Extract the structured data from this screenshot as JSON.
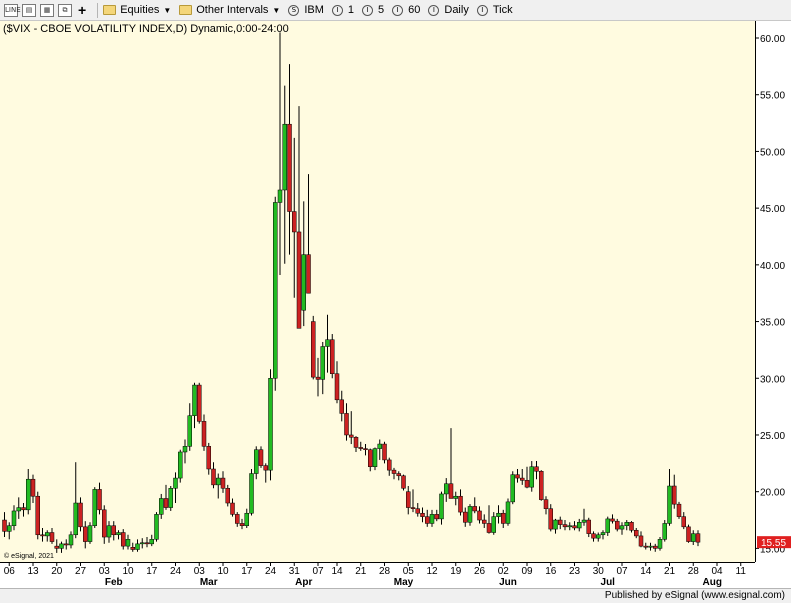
{
  "toolbar": {
    "equities_label": "Equities",
    "other_intervals_label": "Other Intervals",
    "symbol_label": "IBM",
    "interval_1": "1",
    "interval_5": "5",
    "interval_60": "60",
    "daily_label": "Daily",
    "tick_label": "Tick",
    "symbol_icon": "S",
    "interval_icon": "I"
  },
  "footer": {
    "published_by": "Published by eSignal (www.esignal.com)"
  },
  "chart_data": {
    "type": "candlestick",
    "title": "($VIX - CBOE VOLATILITY INDEX,D) Dynamic,0:00-24:00",
    "watermark": "© eSignal, 2021",
    "last_price_label": "15.55",
    "colors": {
      "up": "#22bb22",
      "down": "#cc2222",
      "background": "#fffbe0",
      "last_price": "#e02020"
    },
    "ylim": [
      13.8,
      61.5
    ],
    "yticks": [
      "15.00",
      "20.00",
      "25.00",
      "30.00",
      "35.00",
      "40.00",
      "45.00",
      "50.00",
      "55.00",
      "60.00"
    ],
    "x_tick_labels": [
      {
        "i": 1,
        "label": "06"
      },
      {
        "i": 6,
        "label": "13"
      },
      {
        "i": 11,
        "label": "20"
      },
      {
        "i": 16,
        "label": "27"
      },
      {
        "i": 21,
        "label": "03"
      },
      {
        "i": 26,
        "label": "10"
      },
      {
        "i": 31,
        "label": "17"
      },
      {
        "i": 36,
        "label": "24"
      },
      {
        "i": 41,
        "label": "03"
      },
      {
        "i": 46,
        "label": "10"
      },
      {
        "i": 51,
        "label": "17"
      },
      {
        "i": 56,
        "label": "24"
      },
      {
        "i": 61,
        "label": "31"
      },
      {
        "i": 66,
        "label": "07"
      },
      {
        "i": 70,
        "label": "14"
      },
      {
        "i": 75,
        "label": "21"
      },
      {
        "i": 80,
        "label": "28"
      },
      {
        "i": 85,
        "label": "05"
      },
      {
        "i": 90,
        "label": "12"
      },
      {
        "i": 95,
        "label": "19"
      },
      {
        "i": 100,
        "label": "26"
      },
      {
        "i": 105,
        "label": "02"
      },
      {
        "i": 110,
        "label": "09"
      },
      {
        "i": 115,
        "label": "16"
      },
      {
        "i": 120,
        "label": "23"
      },
      {
        "i": 125,
        "label": "30"
      },
      {
        "i": 130,
        "label": "07"
      },
      {
        "i": 135,
        "label": "14"
      },
      {
        "i": 140,
        "label": "21"
      },
      {
        "i": 145,
        "label": "28"
      },
      {
        "i": 150,
        "label": "04"
      },
      {
        "i": 155,
        "label": "11"
      }
    ],
    "month_labels": [
      {
        "i": 23,
        "label": "Feb"
      },
      {
        "i": 43,
        "label": "Mar"
      },
      {
        "i": 63,
        "label": "Apr"
      },
      {
        "i": 84,
        "label": "May"
      },
      {
        "i": 106,
        "label": "Jun"
      },
      {
        "i": 127,
        "label": "Jul"
      },
      {
        "i": 149,
        "label": "Aug"
      }
    ],
    "ohlc": [
      [
        17.5,
        18.2,
        16.0,
        16.5
      ],
      [
        16.5,
        17.3,
        15.8,
        17.0
      ],
      [
        17.0,
        18.8,
        16.6,
        18.3
      ],
      [
        18.3,
        19.5,
        17.6,
        18.6
      ],
      [
        18.6,
        19.0,
        17.8,
        18.4
      ],
      [
        18.4,
        22.0,
        18.0,
        21.1
      ],
      [
        21.1,
        21.5,
        19.0,
        19.6
      ],
      [
        19.6,
        20.0,
        15.8,
        16.2
      ],
      [
        16.2,
        16.8,
        15.6,
        16.1
      ],
      [
        16.1,
        16.6,
        15.6,
        16.4
      ],
      [
        16.4,
        16.8,
        15.4,
        15.6
      ],
      [
        15.2,
        15.8,
        14.6,
        15.0
      ],
      [
        15.0,
        15.6,
        14.6,
        15.4
      ],
      [
        15.4,
        15.8,
        14.9,
        15.3
      ],
      [
        15.3,
        16.5,
        15.0,
        16.2
      ],
      [
        16.2,
        22.6,
        15.9,
        19.0
      ],
      [
        19.0,
        19.5,
        16.5,
        16.9
      ],
      [
        16.9,
        17.4,
        15.0,
        15.6
      ],
      [
        15.6,
        17.3,
        15.4,
        17.0
      ],
      [
        17.0,
        20.4,
        16.8,
        20.2
      ],
      [
        20.2,
        20.8,
        18.0,
        18.4
      ],
      [
        18.4,
        18.8,
        15.4,
        16.0
      ],
      [
        16.0,
        17.4,
        15.5,
        17.0
      ],
      [
        17.0,
        17.4,
        15.7,
        16.2
      ],
      [
        16.2,
        16.6,
        15.8,
        16.4
      ],
      [
        16.4,
        16.7,
        14.9,
        15.2
      ],
      [
        15.2,
        16.2,
        14.9,
        15.8
      ],
      [
        15.1,
        15.5,
        14.7,
        14.9
      ],
      [
        14.9,
        15.8,
        14.7,
        15.4
      ],
      [
        15.4,
        15.9,
        15.0,
        15.5
      ],
      [
        15.5,
        16.0,
        15.1,
        15.4
      ],
      [
        15.4,
        16.2,
        15.2,
        15.8
      ],
      [
        15.8,
        18.2,
        15.6,
        18.0
      ],
      [
        18.0,
        19.8,
        17.6,
        19.4
      ],
      [
        19.4,
        20.6,
        18.4,
        18.6
      ],
      [
        18.6,
        20.5,
        18.3,
        20.3
      ],
      [
        20.3,
        21.7,
        19.0,
        21.2
      ],
      [
        21.2,
        23.7,
        20.8,
        23.5
      ],
      [
        23.5,
        24.6,
        22.5,
        24.0
      ],
      [
        24.0,
        27.8,
        23.6,
        26.7
      ],
      [
        26.7,
        29.6,
        25.6,
        29.4
      ],
      [
        29.4,
        29.6,
        26.0,
        26.2
      ],
      [
        26.2,
        26.8,
        23.6,
        24.0
      ],
      [
        24.0,
        24.3,
        21.5,
        22.0
      ],
      [
        22.0,
        22.6,
        20.3,
        20.6
      ],
      [
        20.6,
        21.6,
        19.4,
        21.2
      ],
      [
        21.2,
        21.8,
        19.9,
        20.3
      ],
      [
        20.3,
        20.6,
        18.7,
        19.0
      ],
      [
        19.0,
        19.4,
        17.8,
        18.0
      ],
      [
        18.0,
        18.2,
        16.9,
        17.2
      ],
      [
        17.2,
        17.6,
        16.7,
        17.0
      ],
      [
        17.0,
        18.5,
        16.8,
        18.1
      ],
      [
        18.1,
        22.0,
        17.9,
        21.6
      ],
      [
        21.6,
        24.0,
        21.1,
        23.7
      ],
      [
        23.7,
        24.0,
        22.1,
        22.3
      ],
      [
        22.3,
        22.5,
        20.8,
        21.9
      ],
      [
        21.9,
        30.8,
        21.0,
        30.0
      ],
      [
        30.0,
        46.0,
        28.9,
        45.5
      ],
      [
        45.5,
        60.5,
        39.1,
        46.6
      ],
      [
        46.6,
        55.8,
        40.1,
        52.4
      ],
      [
        52.4,
        57.7,
        40.9,
        44.7
      ],
      [
        44.7,
        51.2,
        37.1,
        42.9
      ],
      [
        42.9,
        54.0,
        38.1,
        34.4
      ],
      [
        36.0,
        45.6,
        34.6,
        40.9
      ],
      [
        40.9,
        48.0,
        37.5,
        37.5
      ],
      [
        35.0,
        35.5,
        29.9,
        30.1
      ],
      [
        30.1,
        31.8,
        28.4,
        29.9
      ],
      [
        29.9,
        33.2,
        28.6,
        32.8
      ],
      [
        32.8,
        35.6,
        30.5,
        33.4
      ],
      [
        33.4,
        33.9,
        30.0,
        30.4
      ],
      [
        30.4,
        31.5,
        27.8,
        28.1
      ],
      [
        28.1,
        28.9,
        26.2,
        26.9
      ],
      [
        26.9,
        27.8,
        24.5,
        25.0
      ],
      [
        25.0,
        27.1,
        24.2,
        24.8
      ],
      [
        24.8,
        24.9,
        23.5,
        23.9
      ],
      [
        23.9,
        24.4,
        23.6,
        23.8
      ],
      [
        23.8,
        24.2,
        23.2,
        23.7
      ],
      [
        23.7,
        23.8,
        21.8,
        22.2
      ],
      [
        22.2,
        23.9,
        21.9,
        23.8
      ],
      [
        23.8,
        24.6,
        22.8,
        24.2
      ],
      [
        24.2,
        24.4,
        22.5,
        22.8
      ],
      [
        22.8,
        23.0,
        21.4,
        21.9
      ],
      [
        21.9,
        22.1,
        21.1,
        21.6
      ],
      [
        21.6,
        21.8,
        21.0,
        21.4
      ],
      [
        21.4,
        21.5,
        20.1,
        20.3
      ],
      [
        20.0,
        20.5,
        18.0,
        18.6
      ],
      [
        18.6,
        20.2,
        18.2,
        18.5
      ],
      [
        18.5,
        19.0,
        17.8,
        18.1
      ],
      [
        18.1,
        18.6,
        17.3,
        17.8
      ],
      [
        17.8,
        18.4,
        16.9,
        17.2
      ],
      [
        17.2,
        18.4,
        16.9,
        18.0
      ],
      [
        18.0,
        18.4,
        17.4,
        17.6
      ],
      [
        17.6,
        20.0,
        17.1,
        19.8
      ],
      [
        19.8,
        21.2,
        19.1,
        20.7
      ],
      [
        20.7,
        25.6,
        20.1,
        19.4
      ],
      [
        19.4,
        20.0,
        18.8,
        19.6
      ],
      [
        19.6,
        20.2,
        17.9,
        18.2
      ],
      [
        18.2,
        18.6,
        16.9,
        17.3
      ],
      [
        17.3,
        18.9,
        17.0,
        18.7
      ],
      [
        18.7,
        19.5,
        18.1,
        18.3
      ],
      [
        18.3,
        18.7,
        17.2,
        17.5
      ],
      [
        17.5,
        18.0,
        16.8,
        17.2
      ],
      [
        17.2,
        18.8,
        16.3,
        16.4
      ],
      [
        16.4,
        18.2,
        16.2,
        17.8
      ],
      [
        17.8,
        18.8,
        17.2,
        18.1
      ],
      [
        18.1,
        18.4,
        16.8,
        17.2
      ],
      [
        17.2,
        19.4,
        17.0,
        19.1
      ],
      [
        19.1,
        21.8,
        18.9,
        21.5
      ],
      [
        21.5,
        22.0,
        20.8,
        21.2
      ],
      [
        21.2,
        22.0,
        20.6,
        21.0
      ],
      [
        21.0,
        22.2,
        20.3,
        20.4
      ],
      [
        20.4,
        22.7,
        20.0,
        22.2
      ],
      [
        22.2,
        22.7,
        21.1,
        21.8
      ],
      [
        21.8,
        21.9,
        19.2,
        19.3
      ],
      [
        19.3,
        19.6,
        18.0,
        18.5
      ],
      [
        18.5,
        18.9,
        16.5,
        16.7
      ],
      [
        16.7,
        17.6,
        16.3,
        17.5
      ],
      [
        17.5,
        17.8,
        16.7,
        17.1
      ],
      [
        17.1,
        17.5,
        16.6,
        16.9
      ],
      [
        16.9,
        17.3,
        16.6,
        17.0
      ],
      [
        17.0,
        17.4,
        16.6,
        16.8
      ],
      [
        16.8,
        17.6,
        16.5,
        17.3
      ],
      [
        17.3,
        18.5,
        17.0,
        17.5
      ],
      [
        17.5,
        17.7,
        16.0,
        16.3
      ],
      [
        16.3,
        16.5,
        15.6,
        15.9
      ],
      [
        15.9,
        16.4,
        15.6,
        16.2
      ],
      [
        16.2,
        16.6,
        15.8,
        16.4
      ],
      [
        16.4,
        17.8,
        16.1,
        17.6
      ],
      [
        17.6,
        18.0,
        17.2,
        17.4
      ],
      [
        17.4,
        17.6,
        16.5,
        16.7
      ],
      [
        16.7,
        17.3,
        16.2,
        17.0
      ],
      [
        17.0,
        17.5,
        16.6,
        17.3
      ],
      [
        17.3,
        17.4,
        16.4,
        16.6
      ],
      [
        16.6,
        16.8,
        15.9,
        16.1
      ],
      [
        16.1,
        16.5,
        15.1,
        15.2
      ],
      [
        15.2,
        15.5,
        14.9,
        15.1
      ],
      [
        15.1,
        15.5,
        14.8,
        15.2
      ],
      [
        15.2,
        15.4,
        14.7,
        15.0
      ],
      [
        15.0,
        16.0,
        14.8,
        15.8
      ],
      [
        15.8,
        17.5,
        15.6,
        17.2
      ],
      [
        17.2,
        22.0,
        17.0,
        20.5
      ],
      [
        20.5,
        21.5,
        18.5,
        18.9
      ],
      [
        18.9,
        19.1,
        17.6,
        17.8
      ],
      [
        17.8,
        18.2,
        16.7,
        16.9
      ],
      [
        16.9,
        17.1,
        15.5,
        15.6
      ],
      [
        15.6,
        16.6,
        15.3,
        16.3
      ],
      [
        16.3,
        16.6,
        15.2,
        15.55
      ]
    ]
  }
}
